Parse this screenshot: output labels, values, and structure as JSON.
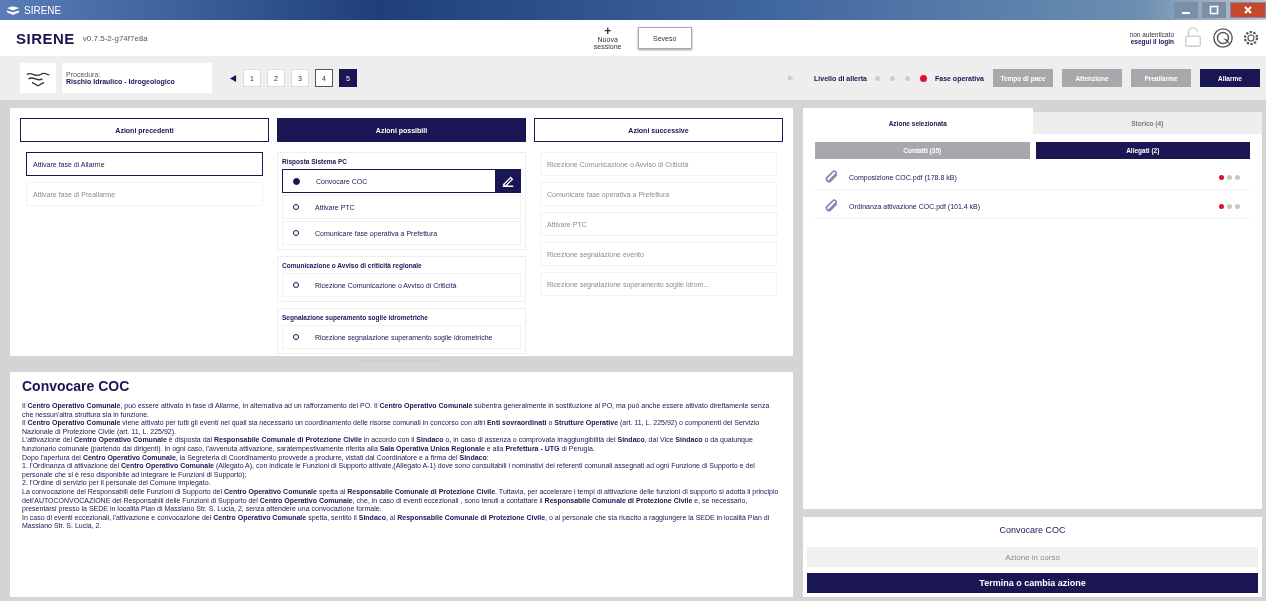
{
  "window": {
    "title": "SIRENE"
  },
  "header": {
    "app_name": "SIRENE",
    "version": "v0.7.5-2-g74f7e8a",
    "new_session": {
      "icon": "+",
      "label": "Nuova sessione"
    },
    "session_tab": "Seveso",
    "auth": {
      "status": "non autenticato",
      "login": "esegui il login"
    }
  },
  "procedure": {
    "label": "Procedura:",
    "name": "Rischio Idraulico - Idrogeologico",
    "pages": [
      {
        "label": "1",
        "selected": false,
        "visited": false
      },
      {
        "label": "2",
        "selected": false,
        "visited": false
      },
      {
        "label": "3",
        "selected": false,
        "visited": false
      },
      {
        "label": "4",
        "selected": false,
        "visited": true
      },
      {
        "label": "5",
        "selected": true,
        "visited": false
      }
    ]
  },
  "alert": {
    "label": "Livello di allerta",
    "levels": [
      {
        "selected": false
      },
      {
        "selected": false
      },
      {
        "selected": false
      },
      {
        "selected": true
      }
    ],
    "phase_label": "Fase operativa",
    "phases": [
      {
        "label": "Tempo di pace",
        "selected": false
      },
      {
        "label": "Attenzione",
        "selected": false
      },
      {
        "label": "Preallarme",
        "selected": false
      },
      {
        "label": "Allarme",
        "selected": true
      }
    ]
  },
  "actions": {
    "columns": [
      {
        "title": "Azioni precedenti",
        "selected": false
      },
      {
        "title": "Azioni possibili",
        "selected": true
      },
      {
        "title": "Azioni successive",
        "selected": false
      }
    ],
    "previous": [
      {
        "label": "Attivare fase di Allarme",
        "disabled": false
      },
      {
        "label": "Attivare fase di Preallarme",
        "disabled": true
      }
    ],
    "possible": [
      {
        "title": "Risposta Sistema PC",
        "options": [
          {
            "label": "Convocare COC",
            "selected": true
          },
          {
            "label": "Attivare PTC",
            "selected": false
          },
          {
            "label": "Comunicare fase operativa a Prefettura",
            "selected": false
          }
        ]
      },
      {
        "title": "Comunicazione o Avviso di criticità regionale",
        "options": [
          {
            "label": "Ricezione Comunicazione o Avviso di Criticità",
            "selected": false
          }
        ]
      },
      {
        "title": "Segnalazione superamento soglie idrometriche",
        "options": [
          {
            "label": "Ricezione segnalazione superamento soglie idrometriche",
            "selected": false
          }
        ]
      }
    ],
    "next": [
      {
        "label": "Ricezione Comunicazione o Avviso di Criticità",
        "disabled": true
      },
      {
        "label": "Comunicare fase operativa a Prefettura",
        "disabled": true
      },
      {
        "label": "Attivare PTC",
        "disabled": true
      },
      {
        "label": "Ricezione segnalazione evento",
        "disabled": true
      },
      {
        "label": "Ricezione segnalazione superamento soglie idrom...",
        "disabled": true
      }
    ]
  },
  "description": {
    "title": "Convocare COC",
    "paragraphs": [
      "Il **Centro Operativo Comunale**, può essere attivato in fase di Allarme, in alternativa ad un rafforzamento del PO. Il **Centro Operativo Comunale** subentra generalmente in sostituzione al PO, ma può anche essere attivato direttamente senza che nessun'altra struttura sia in funzione.",
      "Il **Centro Operativo Comunale** viene attivato per tutti gli eventi nei quali sia necessario un coordinamento delle risorse comunali in concorso con altri **Enti sovraordinati** o **Strutture Operative** (art. 11, L. 225/92) o componenti del Servizio Nazionale di Protezione Civile (art. 11, L. 225/92).",
      "L'attivazione del **Centro Operativo Comunale** è disposta dal **Responsabile Comunale di Protezione Civile** in accordo con il **Sindaco** o, in caso di assenza o comprovata irraggiungibilità del **Sindaco**, dal Vice **Sindaco** o da qualunque funzionario comunale (partendo dai dirigenti). In ogni caso, l'avvenuta attivazione, saràtempestivamente riferita alla **Sala Operativa Unica Regionale** e alla **Prefettura - UTG** di Perugia.",
      "Dopo l'apertura del **Centro Operativo Comunale**, la Segreteria di Coordinamento provvede a produrre, vistati dal Coordinatore e a firma del **Sindaco**:",
      "1. l'Ordinanza di attivazione del **Centro Operativo Comunale** (Allegato A), con indicate le Funzioni di Supporto attivate,(Allegato A-1) dove sono consultabili i nominativi dei referenti comunali assegnati ad ogni Funzione di Supporto e del personale che si è reso disponibile ad integrare le Funzioni di Supporto);",
      "2. l'Ordine di servizio per il personale del Comune impiegato.",
      "La convocazione dei Responsabili delle Funzioni di Supporto del **Centro Operativo Comunale** spetta al **Responsabile Comunale di Protezione Civile**. Tuttavia, per accelerare i tempi di attivazione delle funzioni di supporto si adotta il principio dell'AUTOCONVOCAZIONE dei Responsabili delle Funzioni di Supporto del **Centro Operativo Comunale**, che, in caso di eventi eccezionali , sono tenuti a contattare il **Responsabile Comunale di Protezione Civile** e, se necessario, presentarsi presso la SEDE in località Pian di Massiano Str. S. Lucia, 2, senza attendere una convocazione formale.",
      "In caso di eventi eccezionali, l'attivazione e convocazione del **Centro Operativo Comunale** spetta, sentito il **Sindaco**, al **Responsabile Comunale di Protezione Civile**, o al personale che sia riuscito a raggiungere la SEDE in località Pian di Massiano Str. S. Lucia, 2."
    ]
  },
  "side": {
    "tabs": [
      {
        "label": "Azione selezionata",
        "selected": true
      },
      {
        "label": "Storico (4)",
        "selected": false
      }
    ],
    "subtabs": [
      {
        "label": "Contatti (35)",
        "selected": false
      },
      {
        "label": "Allegati (2)",
        "selected": true
      }
    ],
    "attachments": [
      {
        "name": "Composizione COC.pdf (178.8 kB)",
        "dots": [
          {
            "color": "#e0102e"
          },
          {
            "color": "#c8c8c8"
          },
          {
            "color": "#c8c8c8"
          }
        ]
      },
      {
        "name": "Ordinanza attivazione COC.pdf (101.4 kB)",
        "dots": [
          {
            "color": "#e0102e"
          },
          {
            "color": "#c8c8c8"
          },
          {
            "color": "#c8c8c8"
          }
        ]
      }
    ]
  },
  "current": {
    "title": "Convocare COC",
    "status_button": {
      "label": "Azione in corso",
      "disabled": true
    },
    "end_button": "Termina o cambia azione"
  }
}
